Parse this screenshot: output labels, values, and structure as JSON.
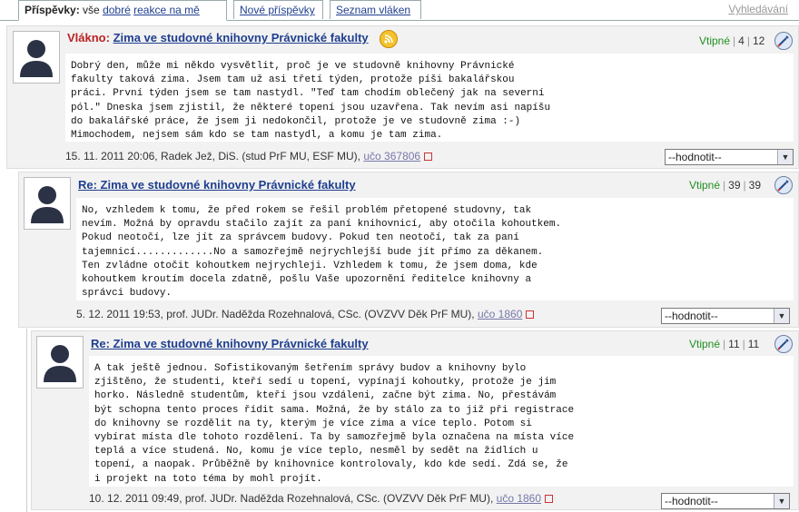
{
  "tabs": {
    "first_label": "Příspěvky:",
    "all": "vše",
    "good": "dobré",
    "reactions": "reakce na mě",
    "new_posts": "Nové příspěvky",
    "thread_list": "Seznam vláken",
    "search": "Vyhledávání"
  },
  "posts": [
    {
      "prefix": "Vlákno:",
      "title": "Zima ve studovné knihovny Právnické fakulty",
      "score_label": "Vtipné",
      "score_a": "4",
      "score_b": "12",
      "body": "Dobrý den, může mi někdo vysvětlit, proč je ve studovně knihovny Právnické\nfakulty taková zima. Jsem tam už asi třetí týden, protože píši bakalářskou\npráci. První týden jsem se tam nastydl. \"Teď tam chodím oblečený jak na severní\npól.\" Dneska jsem zjistil, že některé topení jsou uzavřena. Tak nevím asi napíšu\ndo bakalářské práce, že jsem ji nedokončil, protože je ve studovně zima :-)\nMimochodem, nejsem sám kdo se tam nastydl, a komu je tam zima.",
      "meta": "15. 11. 2011 20:06, Radek Jež, DiS. (stud PrF MU, ESF MU),",
      "uco": "učo 367806",
      "rating": "--hodnotit--"
    },
    {
      "prefix": "",
      "title": "Re: Zima ve studovné knihovny Právnické fakulty",
      "score_label": "Vtipné",
      "score_a": "39",
      "score_b": "39",
      "body": "No, vzhledem k tomu, že před rokem se řešil problém přetopené studovny, tak\nnevím. Možná by opravdu stačilo zajít za paní knihovnicí, aby otočila kohoutkem.\nPokud neotočí, lze jít za správcem budovy. Pokud ten neotočí, tak za paní\ntajemnicí.............No a samozřejmě nejrychlejší bude jít přímo za děkanem.\nTen zvládne otočit kohoutkem nejrychleji. Vzhledem k tomu, že jsem doma, kde\nkohoutkem kroutím docela zdatně, pošlu Vaše upozornění ředitelce knihovny a\nsprávci budovy.",
      "meta": "5. 12. 2011 19:53, prof. JUDr. Naděžda Rozehnalová, CSc. (OVZVV Děk PrF MU),",
      "uco": "učo 1860",
      "rating": "--hodnotit--"
    },
    {
      "prefix": "",
      "title": "Re: Zima ve studovné knihovny Právnické fakulty",
      "score_label": "Vtipné",
      "score_a": "11",
      "score_b": "11",
      "body": "A tak ještě jednou. Sofistikovaným šetřením správy budov a knihovny bylo\nzjištěno, že studenti, kteří sedí u topení, vypínají kohoutky, protože je jim\nhorko. Následně studentům, kteří jsou vzdáleni, začne být zima. No, přestávám\nbýt schopna tento proces řídit sama. Možná, že by stálo za to již při registrace\ndo knihovny se rozdělit na ty, kterým je více zima a více teplo. Potom si\nvybírat místa dle tohoto rozdělení. Ta by samozřejmě byla označena na místa více\nteplá a více studená. No, komu je více teplo, nesměl by sedět na židlích u\ntopení, a naopak. Průběžně by knihovnice kontrolovaly, kdo kde sedí. Zdá se, že\ni projekt na toto téma by mohl projít.",
      "meta": "10. 12. 2011 09:49, prof. JUDr. Naděžda Rozehnalová, CSc. (OVZVV Děk PrF MU),",
      "uco": "učo 1860",
      "rating": "--hodnotit--"
    }
  ]
}
